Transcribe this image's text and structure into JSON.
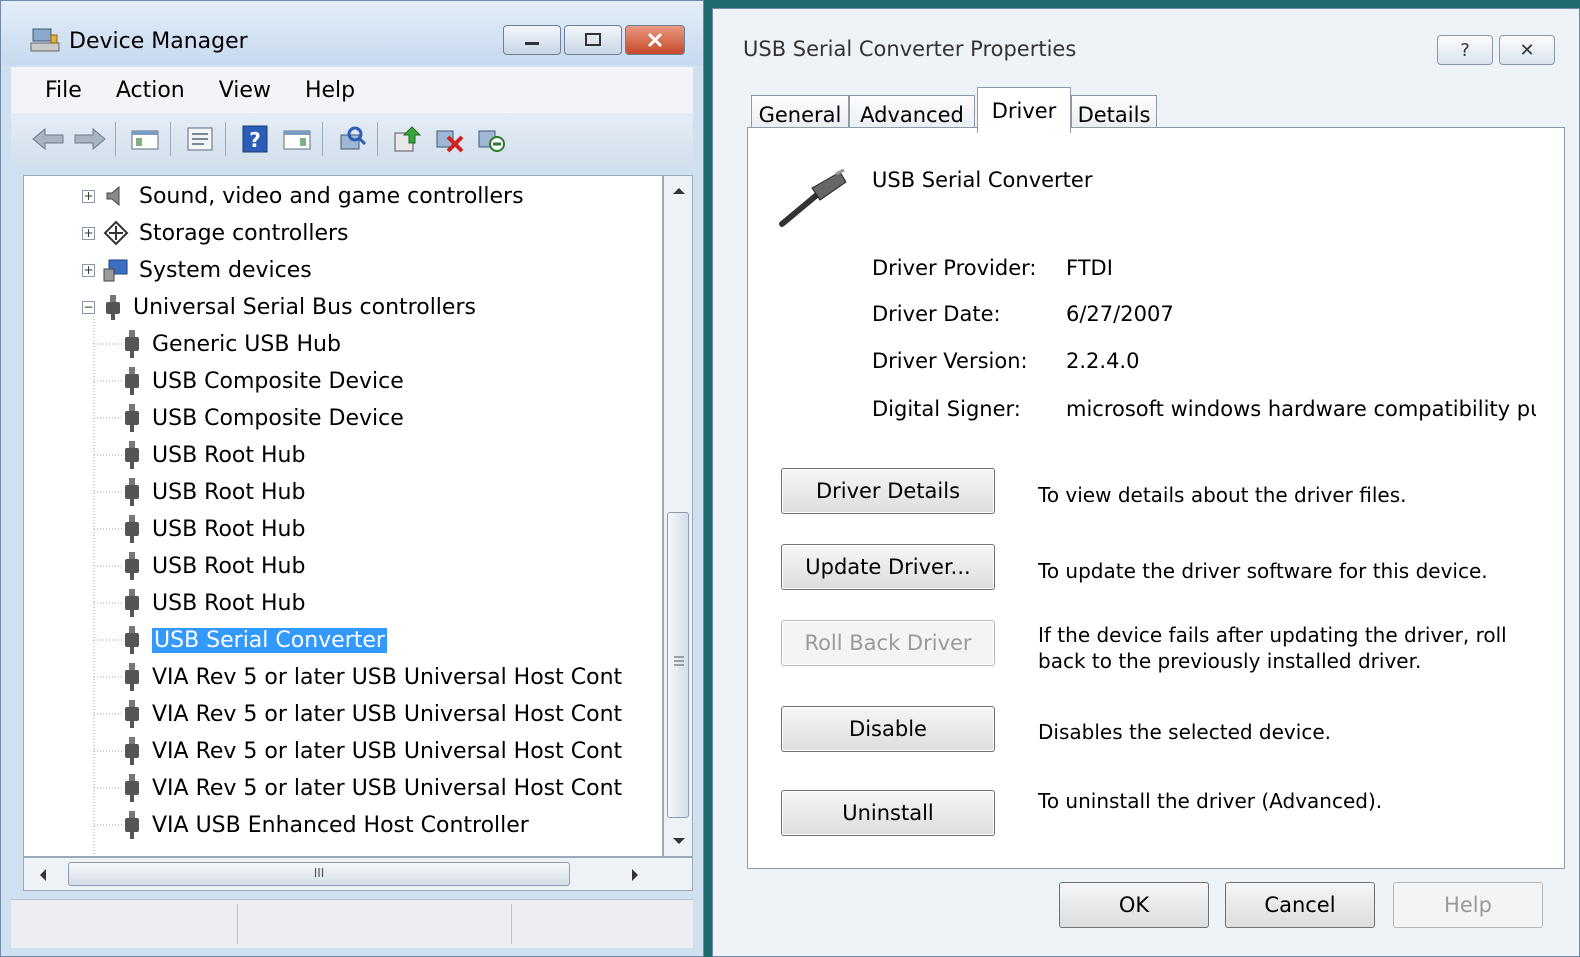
{
  "device_manager": {
    "title": "Device Manager",
    "menu": [
      "File",
      "Action",
      "View",
      "Help"
    ],
    "toolbar_icons": [
      "back-arrow-icon",
      "forward-arrow-icon",
      "show-hide-tree-icon",
      "properties-icon",
      "help-icon",
      "action-pane-icon",
      "scan-hardware-icon",
      "update-driver-icon",
      "disable-device-icon",
      "uninstall-device-icon"
    ],
    "tree": {
      "categories": [
        {
          "label": "Sound, video and game controllers",
          "icon": "speaker-icon",
          "expanded": false
        },
        {
          "label": "Storage controllers",
          "icon": "storage-controller-icon",
          "expanded": false
        },
        {
          "label": "System devices",
          "icon": "system-devices-icon",
          "expanded": false
        },
        {
          "label": "Universal Serial Bus controllers",
          "icon": "usb-icon",
          "expanded": true
        }
      ],
      "usb_children": [
        "Generic USB Hub",
        "USB Composite Device",
        "USB Composite Device",
        "USB Root Hub",
        "USB Root Hub",
        "USB Root Hub",
        "USB Root Hub",
        "USB Root Hub",
        "USB Serial Converter",
        "VIA Rev 5 or later USB Universal Host Cont",
        "VIA Rev 5 or later USB Universal Host Cont",
        "VIA Rev 5 or later USB Universal Host Cont",
        "VIA Rev 5 or later USB Universal Host Cont",
        "VIA USB Enhanced Host Controller"
      ],
      "selected": "USB Serial Converter"
    },
    "hscroll_grip": "III"
  },
  "properties": {
    "title": "USB Serial Converter Properties",
    "caption_help": "?",
    "caption_close": "✕",
    "tabs": [
      "General",
      "Advanced",
      "Driver",
      "Details"
    ],
    "active_tab": "Driver",
    "device_name": "USB Serial Converter",
    "info": {
      "provider_label": "Driver Provider:",
      "provider_value": "FTDI",
      "date_label": "Driver Date:",
      "date_value": "6/27/2007",
      "version_label": "Driver Version:",
      "version_value": "2.2.4.0",
      "signer_label": "Digital Signer:",
      "signer_value": "microsoft windows hardware compatibility publisl"
    },
    "actions": {
      "details_label": "Driver Details",
      "details_desc": "To view details about the driver files.",
      "update_label": "Update Driver...",
      "update_desc": "To update the driver software for this device.",
      "rollback_label": "Roll Back Driver",
      "rollback_desc": "If the device fails after updating the driver, roll back to the previously installed driver.",
      "disable_label": "Disable",
      "disable_desc": "Disables the selected device.",
      "uninstall_label": "Uninstall",
      "uninstall_desc": "To uninstall the driver (Advanced)."
    },
    "buttons": {
      "ok": "OK",
      "cancel": "Cancel",
      "help": "Help"
    }
  },
  "colors": {
    "selection": "#3399ff",
    "desktop": "#1f6b6b"
  }
}
